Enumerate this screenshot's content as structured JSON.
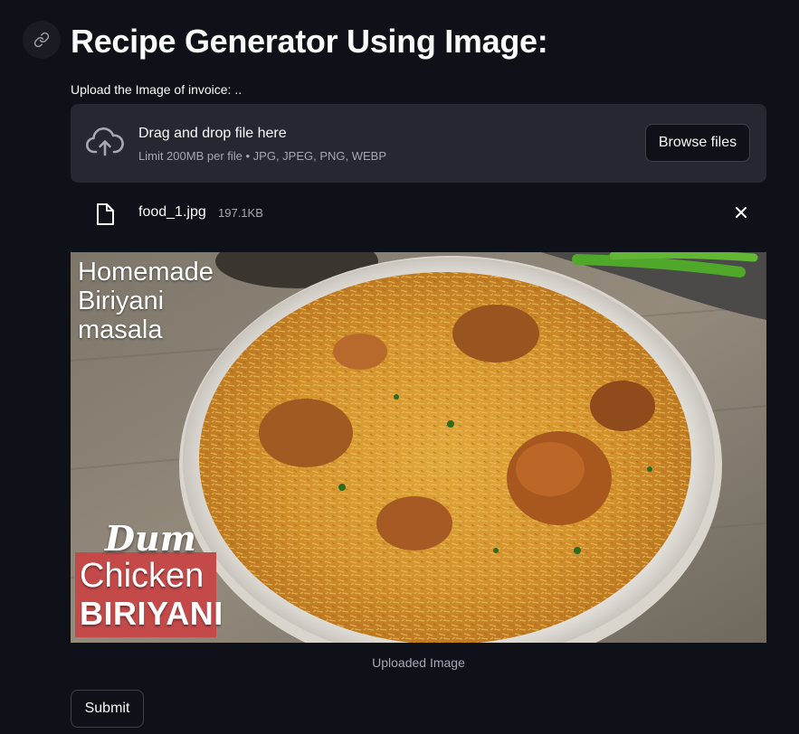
{
  "header": {
    "title": "Recipe Generator Using Image:",
    "anchor_icon": "link-icon"
  },
  "uploader": {
    "label": "Upload the Image of invoice: ..",
    "drop_title": "Drag and drop file here",
    "limit_text": "Limit 200MB per file • JPG, JPEG, PNG, WEBP",
    "browse_label": "Browse files",
    "upload_icon": "cloud-upload-icon"
  },
  "uploaded_file": {
    "name": "food_1.jpg",
    "size": "197.1KB",
    "file_icon": "file-icon",
    "remove_icon": "close-icon"
  },
  "image": {
    "overlay_line_1": "Homemade",
    "overlay_line_2": "Biriyani",
    "overlay_line_3": "masala",
    "badge_line_1": "Dum",
    "badge_line_2": "Chicken",
    "badge_line_3": "BIRIYANI",
    "caption": "Uploaded Image"
  },
  "actions": {
    "submit_label": "Submit"
  },
  "colors": {
    "background": "#0e1117",
    "dropzone": "#262730",
    "text_primary": "#fafafa",
    "text_muted": "#a3a8b4",
    "button_border": "#3d3f4a",
    "badge_red": "#c44a4a"
  }
}
